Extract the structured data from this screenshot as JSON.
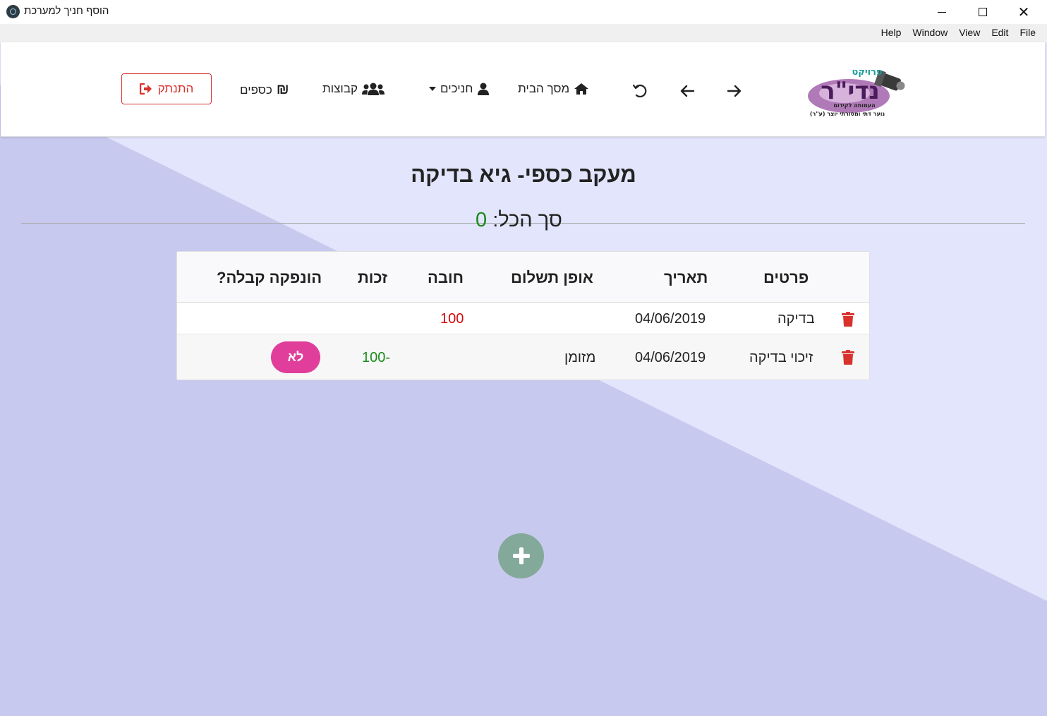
{
  "window": {
    "title": "הוסף חניך למערכת",
    "menu": [
      "Help",
      "Window",
      "View",
      "Edit",
      "File"
    ]
  },
  "nav": {
    "home": "מסך הבית",
    "students": "חניכים",
    "groups": "קבוצות",
    "money": "כספים",
    "logout": "התנתק"
  },
  "logo": {
    "line1": "פרויקט",
    "line2": "נדי\"ר",
    "line3": "העמותה לקידום",
    "line4": "נוער דתי ומסורתי יוצר (ע\"ר)"
  },
  "page": {
    "title": "מעקב כספי- גיא בדיקה",
    "total_label": "סך הכל:",
    "total_value": "0"
  },
  "table": {
    "headers": {
      "details": "פרטים",
      "date": "תאריך",
      "payment_method": "אופן תשלום",
      "debit": "חובה",
      "credit": "זכות",
      "receipt": "הונפקה קבלה?"
    },
    "rows": [
      {
        "details": "בדיקה",
        "date": "04/06/2019",
        "payment_method": "",
        "debit": "100",
        "credit": "",
        "receipt": ""
      },
      {
        "details": "זיכוי בדיקה",
        "date": "04/06/2019",
        "payment_method": "מזומן",
        "debit": "",
        "credit": "-100",
        "receipt": "לא"
      }
    ]
  },
  "colors": {
    "accent_pink": "#e03e9a",
    "debit_red": "#d4090a",
    "credit_green": "#1a8a1a",
    "fab": "#83a99a",
    "logout_red": "#d9322d"
  }
}
